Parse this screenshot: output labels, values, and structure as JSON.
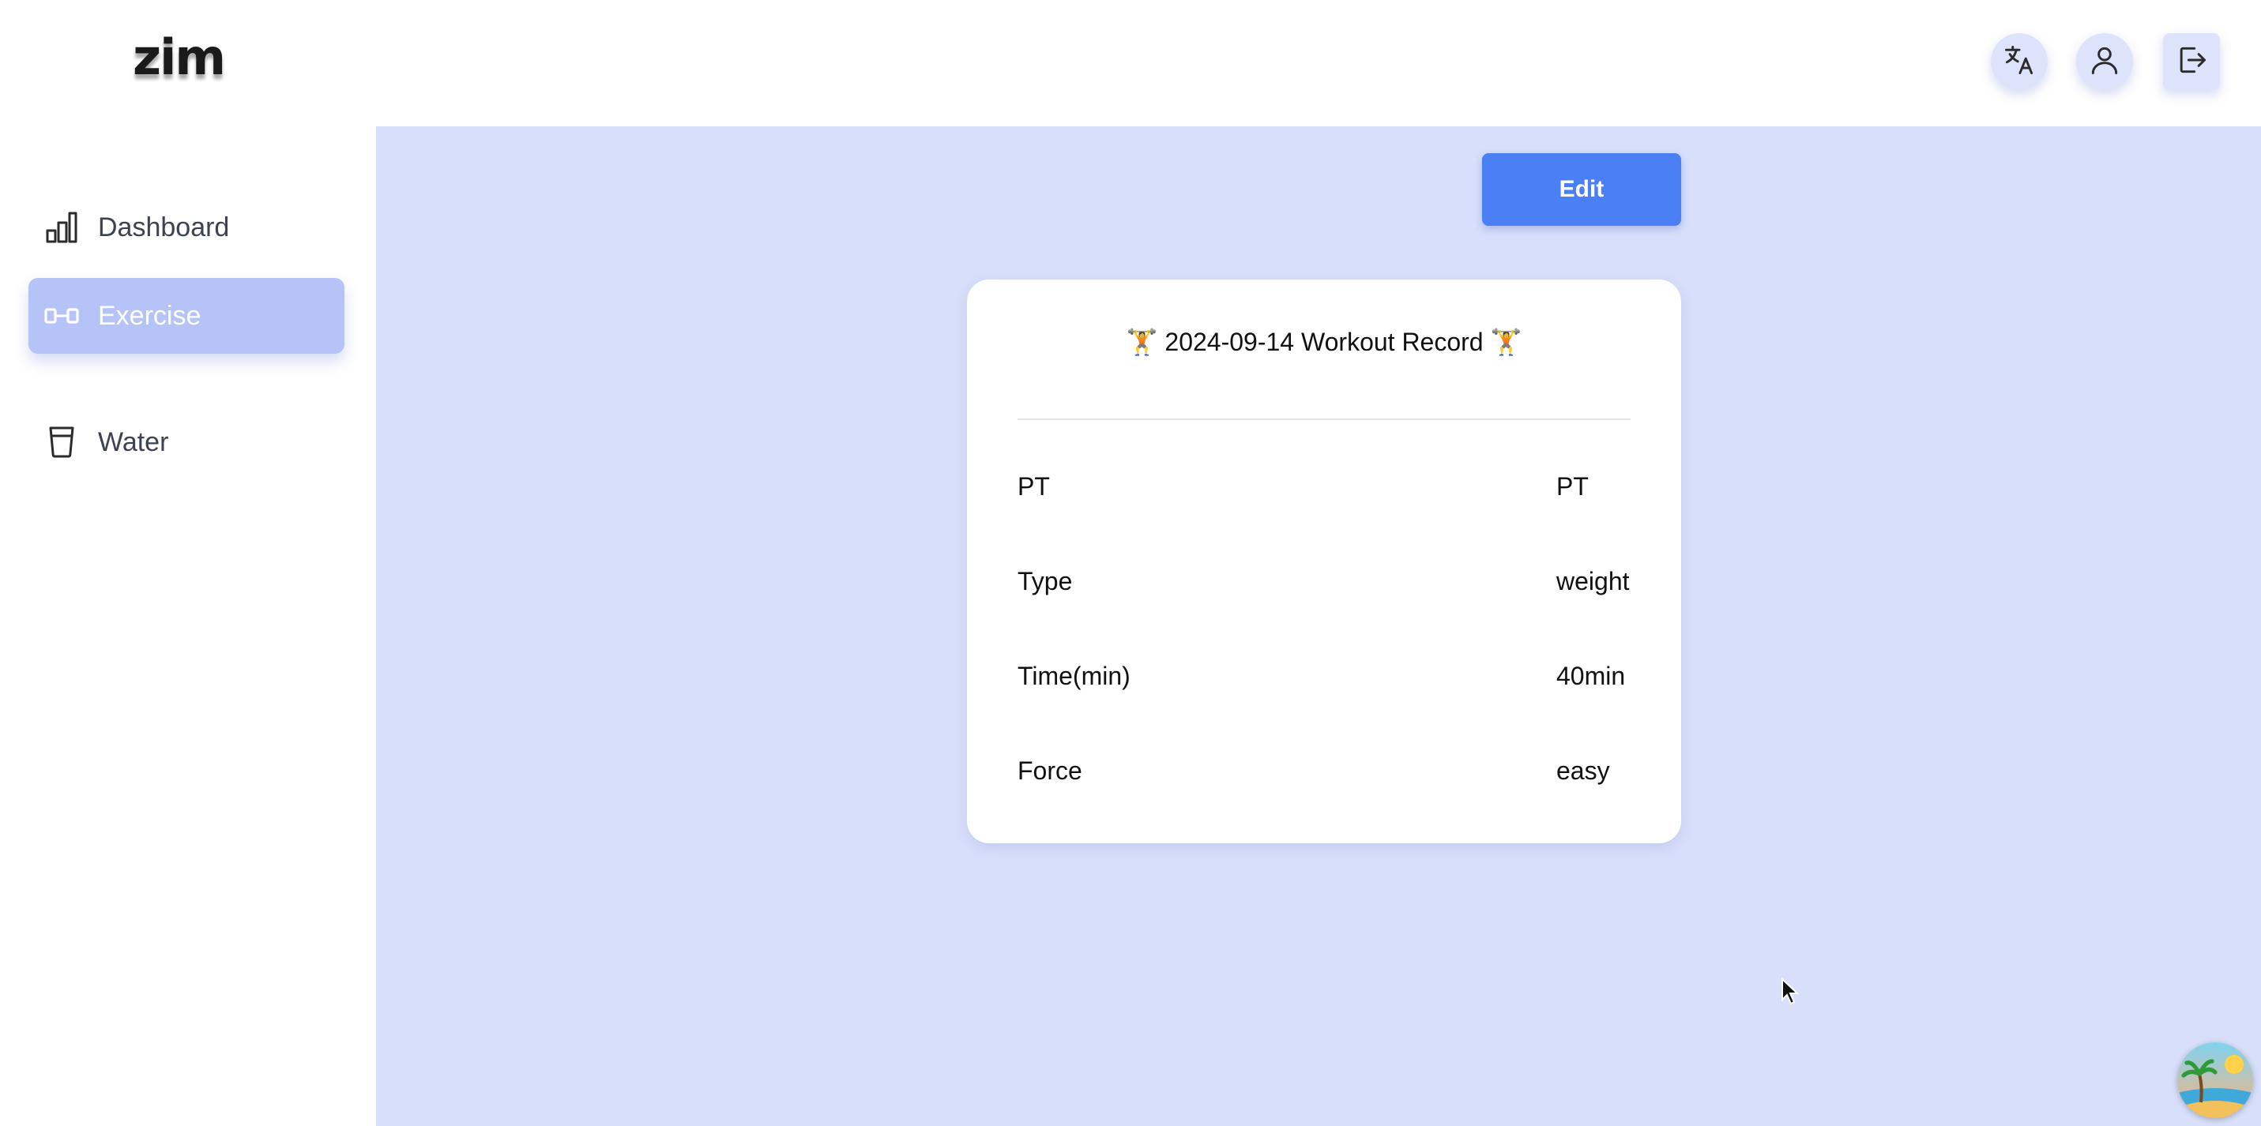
{
  "app": {
    "logo_text": "zim"
  },
  "header": {
    "icons": [
      "translate-icon",
      "user-icon",
      "logout-icon"
    ]
  },
  "sidebar": {
    "items": [
      {
        "label": "Dashboard",
        "icon": "bar-chart-icon",
        "active": false
      },
      {
        "label": "Exercise",
        "icon": "dumbbell-icon",
        "active": true
      },
      {
        "label": "Water",
        "icon": "cup-icon",
        "active": false
      }
    ]
  },
  "toolbar": {
    "edit_label": "Edit"
  },
  "record": {
    "title": "🏋️ 2024-09-14 Workout Record 🏋️",
    "rows": [
      {
        "label": "PT",
        "value": "PT"
      },
      {
        "label": "Type",
        "value": "weight"
      },
      {
        "label": "Time(min)",
        "value": "40min"
      },
      {
        "label": "Force",
        "value": "easy"
      }
    ]
  },
  "colors": {
    "accent": "#4b80f5",
    "main_background": "#d8dffa",
    "active_nav": "#b6c3f7",
    "header_button_bg": "#dde3fb"
  }
}
